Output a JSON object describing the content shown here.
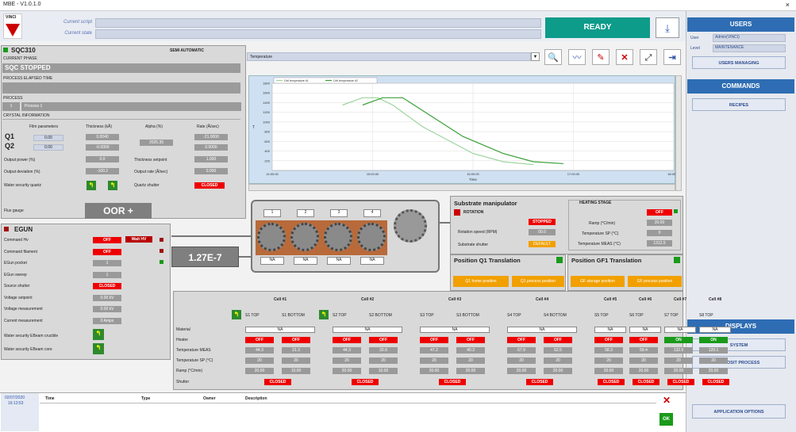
{
  "window": {
    "title": "MBE - V1.0.1.0",
    "close": "×"
  },
  "topbar": {
    "logo_text": "VINCI",
    "script_label": "Current script",
    "state_label": "Current state",
    "ready": "READY",
    "download_icon": "⤓"
  },
  "users": {
    "header": "USERS",
    "user_label": "User",
    "user_value": "Admin(VINCI)",
    "level_label": "Level",
    "level_value": "MAINTENANCE",
    "manage": "USERS MANAGING"
  },
  "commands": {
    "header": "COMMANDS",
    "recipes": "RECIPES"
  },
  "displays": {
    "header": "DISPLAYS",
    "system": "SYSTEM",
    "deposit": "DEPOSIT PROCESS",
    "app_options": "APPLICATION OPTIONS"
  },
  "sqc": {
    "title": "SQC310",
    "mode": "SEMI AUTOMATIC",
    "phase_label": "CURRENT PHASE",
    "phase": "SQC STOPPED",
    "elapsed_label": "PROCESS ELAPSED TIME",
    "process_label": "PROCESS",
    "process_num": "1",
    "process_name": "Process 1",
    "crystal_label": "CRYSTAL INFORMATION",
    "col_film": "Film parameters",
    "col_thick": "Thickness (kÅ)",
    "col_alpha": "Alpha (%)",
    "col_rate": "Rate (Å/sec)",
    "q1": "Q1",
    "q2": "Q2",
    "q1_film": "0.00",
    "q2_film": "0.00",
    "q1_thick": "0.0040",
    "q2_thick": "-0.0000",
    "alpha": "2025.35",
    "q1_rate": "-21.0000",
    "q2_rate": "0.0000",
    "out_power_label": "Output power (%)",
    "out_power": "0.0",
    "thick_sp_label": "Thickness setpoint",
    "thick_sp": "1.000",
    "out_dev_label": "Output deviation (%)",
    "out_dev": "-100.2",
    "out_rate_label": "Output rate (Å/sec)",
    "out_rate": "0.000",
    "water_label": "Water security quartz",
    "shutter_label": "Quartz shutter",
    "shutter": "CLOSED"
  },
  "gauge": {
    "label": "Flux gauge",
    "value": "OOR +",
    "pressure": "1.27E-7"
  },
  "egun": {
    "title": "EGUN",
    "rows": [
      {
        "label": "Command Hv",
        "value": "OFF"
      },
      {
        "label": "Command filament",
        "value": "OFF"
      },
      {
        "label": "EGun pocket",
        "value": "1"
      },
      {
        "label": "EGun sweep",
        "value": "1"
      },
      {
        "label": "Source shutter",
        "value": "CLOSED"
      },
      {
        "label": "Voltage setpoint",
        "value": "0.00 kV"
      },
      {
        "label": "Voltage measurement",
        "value": "0.00 kV"
      },
      {
        "label": "Current measurement",
        "value": "0 Amps"
      }
    ],
    "wait_hv": "Wait HV",
    "water1": "Water security EBeam crucible",
    "water2": "Water security EBeam core"
  },
  "chart_panel": {
    "dropdown": "Temperature",
    "time_label": "Time",
    "y_label": "T"
  },
  "chart_data": {
    "type": "line",
    "title": "",
    "xlabel": "Time",
    "ylabel": "T",
    "x_ticks": [
      "14:00:00",
      "15:00:00",
      "16:00:00",
      "17:00:00",
      "18:00:00"
    ],
    "y_ticks": [
      "1800",
      "1600",
      "1400",
      "1200",
      "1000",
      "800",
      "600",
      "400",
      "200"
    ],
    "xlim": [
      14.0,
      18.0
    ],
    "ylim": [
      0,
      1800
    ],
    "series": [
      {
        "name": "Cell temperature #1",
        "color": "#9cd49c",
        "x": [
          14.7,
          14.9,
          15.05,
          15.2,
          15.5,
          16.0,
          16.3,
          16.6
        ],
        "y": [
          1350,
          1500,
          1500,
          1350,
          900,
          350,
          180,
          120
        ]
      },
      {
        "name": "Cell temperature #2",
        "color": "#3aa03a",
        "x": [
          14.9,
          15.1,
          15.3,
          15.6,
          15.9,
          16.3,
          16.6,
          16.9
        ],
        "y": [
          1350,
          1500,
          1500,
          1100,
          700,
          350,
          180,
          140
        ]
      }
    ]
  },
  "cells_diag": {
    "slots": [
      "1",
      "2",
      "3",
      "4"
    ],
    "na": [
      "NA",
      "NA",
      "NA",
      "NA"
    ]
  },
  "substrate": {
    "title": "Substrate manipulator",
    "rotation": "ROTATION",
    "stopped": "STOPPED",
    "speed_label": "Rotation speed (RPM)",
    "speed": "00.0",
    "shutter_label": "Substrate shutter",
    "shutter": "DEFAULT",
    "heating": "HEATING STAGE",
    "heat_state": "OFF",
    "ramp_label": "Ramp (°C/min)",
    "ramp": "20.00",
    "tsp_label": "Temperature SP (°C)",
    "tsp": "0",
    "tmeas_label": "Temperature MEAS (°C)",
    "tmeas": "1312.5",
    "pos1_title": "Position Q1 Translation",
    "pos2_title": "Position GF1 Translation",
    "q1_home": "Q1 home position",
    "q1_process": "Q1 process position",
    "gf_storage": "GF storage position",
    "gf_process": "GF process position"
  },
  "cells_table": {
    "row_labels": [
      "Material",
      "Heater",
      "Temperature MEAS",
      "Temperature SP (°C)",
      "Ramp (°C/min)",
      "Shutter"
    ],
    "cells": [
      {
        "cell": "Cell #1",
        "subs": [
          "S1 TOP",
          "S1 BOTTOM"
        ],
        "material": "NA",
        "heater": [
          "OFF",
          "OFF"
        ],
        "tmeas": [
          "44.3",
          "21.3"
        ],
        "tsp": [
          "20",
          "20"
        ],
        "ramp": [
          "20.00",
          "10.00"
        ],
        "shutter": "CLOSED"
      },
      {
        "cell": "Cell #2",
        "subs": [
          "S2 TOP",
          "S2 BOTTOM"
        ],
        "material": "NA",
        "heater": [
          "OFF",
          "OFF"
        ],
        "tmeas": [
          "44.3",
          "20.9"
        ],
        "tsp": [
          "20",
          "20"
        ],
        "ramp": [
          "20.00",
          "10.00"
        ],
        "shutter": "CLOSED"
      },
      {
        "cell": "Cell #3",
        "subs": [
          "S3 TOP",
          "S3 BOTTOM"
        ],
        "material": "NA",
        "heater": [
          "OFF",
          "OFF"
        ],
        "tmeas": [
          "47.2",
          "40.3"
        ],
        "tsp": [
          "20",
          "20"
        ],
        "ramp": [
          "20.00",
          "20.00"
        ],
        "shutter": "CLOSED"
      },
      {
        "cell": "Cell #4",
        "subs": [
          "S4 TOP",
          "S4 BOTTOM"
        ],
        "material": "NA",
        "heater": [
          "OFF",
          "OFF"
        ],
        "tmeas": [
          "67.9",
          "52.5"
        ],
        "tsp": [
          "20",
          "20"
        ],
        "ramp": [
          "20.00",
          "20.00"
        ],
        "shutter": "CLOSED"
      },
      {
        "cell": "Cell #5",
        "subs": [
          "S5 TOP"
        ],
        "material": "NA",
        "heater": [
          "OFF"
        ],
        "tmeas": [
          "58.3"
        ],
        "tsp": [
          "20"
        ],
        "ramp": [
          "20.00"
        ],
        "shutter": "CLOSED"
      },
      {
        "cell": "Cell #6",
        "subs": [
          "S6 TOP"
        ],
        "material": "NA",
        "heater": [
          "OFF"
        ],
        "tmeas": [
          "59.4"
        ],
        "tsp": [
          "20"
        ],
        "ramp": [
          "20.00"
        ],
        "shutter": "CLOSED"
      },
      {
        "cell": "Cell #7",
        "subs": [
          "S7 TOP"
        ],
        "material": "NA",
        "heater": [
          "ON"
        ],
        "tmeas": [
          "132.5"
        ],
        "tsp": [
          "20"
        ],
        "ramp": [
          "20.00"
        ],
        "shutter": "CLOSED"
      },
      {
        "cell": "Cell #8",
        "subs": [
          "S8 TOP"
        ],
        "material": "NA",
        "heater": [
          "ON"
        ],
        "tmeas": [
          "129.1"
        ],
        "tsp": [
          "20"
        ],
        "ramp": [
          "20.00"
        ],
        "shutter": "CLOSED"
      }
    ]
  },
  "log": {
    "date": "02/07/2020",
    "time": "16:13:53",
    "cols": [
      "Time",
      "Type",
      "Owner",
      "Description"
    ],
    "ok": "OK",
    "clear": "✕"
  }
}
